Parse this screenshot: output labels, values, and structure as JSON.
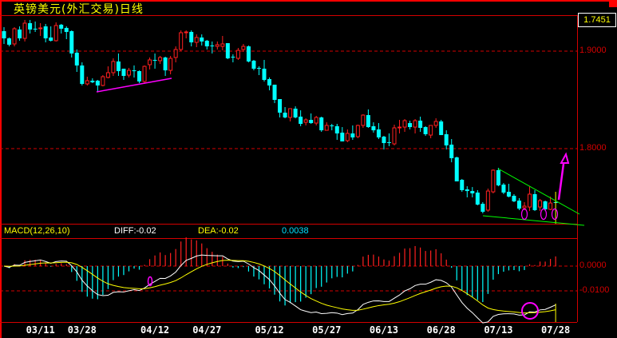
{
  "header": {
    "title": "英镑美元(外汇交易)日线"
  },
  "indicator": {
    "label": "MACD(12,26,10)",
    "diff": "DIFF:-0.02",
    "dea": "DEA:-0.02",
    "macd": "0.0038"
  },
  "colors": {
    "up": "#ff2020",
    "down": "#00ffff",
    "grid": "#d40000",
    "diff": "#ffffff",
    "dea": "#ffff00",
    "annotation": "#ff00ff",
    "trendline": "#00ff00"
  },
  "chart_data": {
    "type": "candlestick",
    "title": "英镑美元(外汇交易)日线",
    "current_price": "1.7451",
    "y_ticks": [
      "1.9000",
      "1.8000"
    ],
    "y_tick_values": [
      1.9,
      1.8
    ],
    "ylim": [
      1.723,
      1.937
    ],
    "macd_ticks": [
      "0.0000",
      "-0.0100"
    ],
    "macd_tick_values": [
      0,
      -0.01
    ],
    "x_ticks": [
      {
        "label": "03/11",
        "candle": 7
      },
      {
        "label": "03/28",
        "candle": 15
      },
      {
        "label": "04/12",
        "candle": 29
      },
      {
        "label": "04/27",
        "candle": 39
      },
      {
        "label": "05/12",
        "candle": 51
      },
      {
        "label": "05/27",
        "candle": 62
      },
      {
        "label": "06/13",
        "candle": 73
      },
      {
        "label": "06/28",
        "candle": 84
      },
      {
        "label": "07/13",
        "candle": 95
      },
      {
        "label": "07/28",
        "candle": 106
      }
    ],
    "ohlc": [
      [
        1.9205,
        1.9246,
        1.9074,
        1.9131
      ],
      [
        1.9131,
        1.914,
        1.9049,
        1.9066
      ],
      [
        1.9074,
        1.9246,
        1.9049,
        1.923
      ],
      [
        1.9222,
        1.9254,
        1.9107,
        1.9131
      ],
      [
        1.9131,
        1.932,
        1.9099,
        1.9287
      ],
      [
        1.9287,
        1.932,
        1.9181,
        1.9222
      ],
      [
        1.923,
        1.9304,
        1.9197,
        1.9222
      ],
      [
        1.923,
        1.9287,
        1.9156,
        1.9238
      ],
      [
        1.9254,
        1.9279,
        1.909,
        1.9131
      ],
      [
        1.914,
        1.9254,
        1.9099,
        1.9107
      ],
      [
        1.9107,
        1.9295,
        1.9099,
        1.9263
      ],
      [
        1.9271,
        1.9279,
        1.9181,
        1.923
      ],
      [
        1.9238,
        1.9254,
        1.9123,
        1.9197
      ],
      [
        1.9205,
        1.9213,
        1.8935,
        1.8976
      ],
      [
        1.8984,
        1.9017,
        1.8787,
        1.8853
      ],
      [
        1.8853,
        1.8885,
        1.8648,
        1.8664
      ],
      [
        1.8664,
        1.8738,
        1.8648,
        1.8697
      ],
      [
        1.8697,
        1.8721,
        1.8672,
        1.868
      ],
      [
        1.8697,
        1.8705,
        1.8582,
        1.8648
      ],
      [
        1.8648,
        1.8754,
        1.8639,
        1.8738
      ],
      [
        1.873,
        1.8844,
        1.8721,
        1.8779
      ],
      [
        1.8779,
        1.8926,
        1.8746,
        1.8894
      ],
      [
        1.8894,
        1.8976,
        1.8746,
        1.8795
      ],
      [
        1.882,
        1.882,
        1.8705,
        1.8746
      ],
      [
        1.8754,
        1.8828,
        1.873,
        1.8803
      ],
      [
        1.8803,
        1.8853,
        1.873,
        1.8795
      ],
      [
        1.8795,
        1.8803,
        1.8672,
        1.8689
      ],
      [
        1.8689,
        1.8853,
        1.8664,
        1.8844
      ],
      [
        1.8861,
        1.8935,
        1.8812,
        1.891
      ],
      [
        1.891,
        1.8976,
        1.882,
        1.891
      ],
      [
        1.8902,
        1.8951,
        1.8869,
        1.8935
      ],
      [
        1.8935,
        1.8943,
        1.8746,
        1.8803
      ],
      [
        1.8803,
        1.8951,
        1.8762,
        1.8926
      ],
      [
        1.8935,
        1.9049,
        1.8885,
        1.9017
      ],
      [
        1.9017,
        1.9213,
        1.9,
        1.9189
      ],
      [
        1.9189,
        1.9213,
        1.9131,
        1.9197
      ],
      [
        1.9197,
        1.9213,
        1.9049,
        1.909
      ],
      [
        1.909,
        1.9172,
        1.9041,
        1.914
      ],
      [
        1.914,
        1.9172,
        1.9058,
        1.9099
      ],
      [
        1.9107,
        1.9115,
        1.9017,
        1.9049
      ],
      [
        1.9058,
        1.9099,
        1.8976,
        1.9058
      ],
      [
        1.9049,
        1.9099,
        1.9017,
        1.9066
      ],
      [
        1.9049,
        1.9156,
        1.9008,
        1.9074
      ],
      [
        1.9082,
        1.9082,
        1.8918,
        1.8926
      ],
      [
        1.8943,
        1.8967,
        1.8885,
        1.8943
      ],
      [
        1.8926,
        1.9033,
        1.891,
        1.9008
      ],
      [
        1.9017,
        1.9074,
        1.8992,
        1.9049
      ],
      [
        1.9049,
        1.9058,
        1.8885,
        1.8894
      ],
      [
        1.8902,
        1.891,
        1.8803,
        1.882
      ],
      [
        1.8828,
        1.8844,
        1.8754,
        1.882
      ],
      [
        1.882,
        1.891,
        1.8689,
        1.8705
      ],
      [
        1.8713,
        1.873,
        1.8598,
        1.8648
      ],
      [
        1.8656,
        1.8656,
        1.8467,
        1.85
      ],
      [
        1.8508,
        1.8508,
        1.832,
        1.8369
      ],
      [
        1.8369,
        1.8426,
        1.8311,
        1.832
      ],
      [
        1.832,
        1.841,
        1.8279,
        1.841
      ],
      [
        1.841,
        1.8434,
        1.8311,
        1.832
      ],
      [
        1.8328,
        1.8393,
        1.823,
        1.8254
      ],
      [
        1.827,
        1.8311,
        1.8238,
        1.8295
      ],
      [
        1.8295,
        1.8361,
        1.8254,
        1.8262
      ],
      [
        1.8262,
        1.8336,
        1.8238,
        1.832
      ],
      [
        1.832,
        1.8328,
        1.8172,
        1.8188
      ],
      [
        1.8188,
        1.827,
        1.8188,
        1.8238
      ],
      [
        1.8238,
        1.8254,
        1.8188,
        1.8238
      ],
      [
        1.823,
        1.8254,
        1.809,
        1.8156
      ],
      [
        1.8164,
        1.8221,
        1.8074,
        1.8074
      ],
      [
        1.8082,
        1.8197,
        1.8066,
        1.8156
      ],
      [
        1.8156,
        1.8238,
        1.809,
        1.8115
      ],
      [
        1.8123,
        1.8246,
        1.8107,
        1.8238
      ],
      [
        1.8238,
        1.8352,
        1.8213,
        1.8344
      ],
      [
        1.8344,
        1.8402,
        1.8213,
        1.8221
      ],
      [
        1.823,
        1.827,
        1.8164,
        1.8188
      ],
      [
        1.8197,
        1.8262,
        1.8098,
        1.8115
      ],
      [
        1.8123,
        1.8131,
        1.7991,
        1.8057
      ],
      [
        1.8066,
        1.8156,
        1.8025,
        1.8066
      ],
      [
        1.8049,
        1.8246,
        1.8033,
        1.8213
      ],
      [
        1.8213,
        1.8295,
        1.8156,
        1.8221
      ],
      [
        1.8221,
        1.8303,
        1.8172,
        1.8287
      ],
      [
        1.8262,
        1.8287,
        1.8197,
        1.8221
      ],
      [
        1.8221,
        1.8303,
        1.8156,
        1.8287
      ],
      [
        1.8287,
        1.8328,
        1.8172,
        1.8213
      ],
      [
        1.8221,
        1.823,
        1.8131,
        1.8148
      ],
      [
        1.8139,
        1.8238,
        1.8107,
        1.8238
      ],
      [
        1.8238,
        1.8311,
        1.8213,
        1.8279
      ],
      [
        1.8279,
        1.8295,
        1.8139,
        1.8139
      ],
      [
        1.8148,
        1.8188,
        1.7991,
        1.8033
      ],
      [
        1.8041,
        1.8098,
        1.786,
        1.7902
      ],
      [
        1.791,
        1.7918,
        1.7664,
        1.7664
      ],
      [
        1.768,
        1.7689,
        1.7557,
        1.7574
      ],
      [
        1.7582,
        1.7614,
        1.75,
        1.7565
      ],
      [
        1.7565,
        1.7606,
        1.75,
        1.7541
      ],
      [
        1.7549,
        1.7574,
        1.7418,
        1.7426
      ],
      [
        1.7434,
        1.7451,
        1.7336,
        1.7352
      ],
      [
        1.7369,
        1.759,
        1.7352,
        1.7565
      ],
      [
        1.7557,
        1.7787,
        1.7541,
        1.7779
      ],
      [
        1.7779,
        1.7803,
        1.7614,
        1.7623
      ],
      [
        1.7631,
        1.7647,
        1.7533,
        1.7549
      ],
      [
        1.7557,
        1.7639,
        1.75,
        1.7508
      ],
      [
        1.7516,
        1.7533,
        1.7451,
        1.7459
      ],
      [
        1.7467,
        1.7492,
        1.7369,
        1.7385
      ],
      [
        1.7393,
        1.7451,
        1.7369,
        1.741
      ],
      [
        1.7401,
        1.7614,
        1.736,
        1.7533
      ],
      [
        1.7533,
        1.7574,
        1.736,
        1.7369
      ],
      [
        1.7401,
        1.7483,
        1.736,
        1.7467
      ],
      [
        1.7459,
        1.7467,
        1.736,
        1.7377
      ],
      [
        1.7377,
        1.7508,
        1.7369,
        1.7442
      ],
      [
        1.7451,
        1.7459,
        1.7442,
        1.7451
      ]
    ],
    "macd_params": [
      12,
      26,
      10
    ],
    "grid": "dashed at tick levels"
  }
}
